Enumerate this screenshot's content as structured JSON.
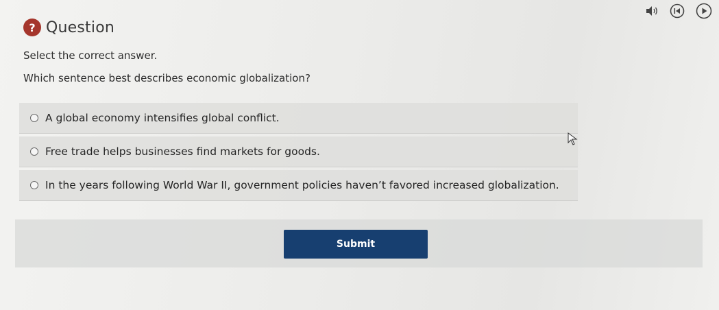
{
  "header": {
    "icon_glyph": "?",
    "title": "Question",
    "icon_color": "#a5362c"
  },
  "media_controls": {
    "audio_icon": "speaker-icon",
    "restart_icon": "restart-icon",
    "play_icon": "play-icon"
  },
  "question": {
    "instruction": "Select the correct answer.",
    "prompt": "Which sentence best describes economic globalization?"
  },
  "options": [
    {
      "label": "A global economy intensifies global conflict.",
      "selected": false
    },
    {
      "label": "Free trade helps businesses find markets for goods.",
      "selected": false
    },
    {
      "label": "In the years following World War II, government policies haven’t favored increased globalization.",
      "selected": false
    }
  ],
  "submit": {
    "label": "Submit",
    "color": "#173f70"
  }
}
